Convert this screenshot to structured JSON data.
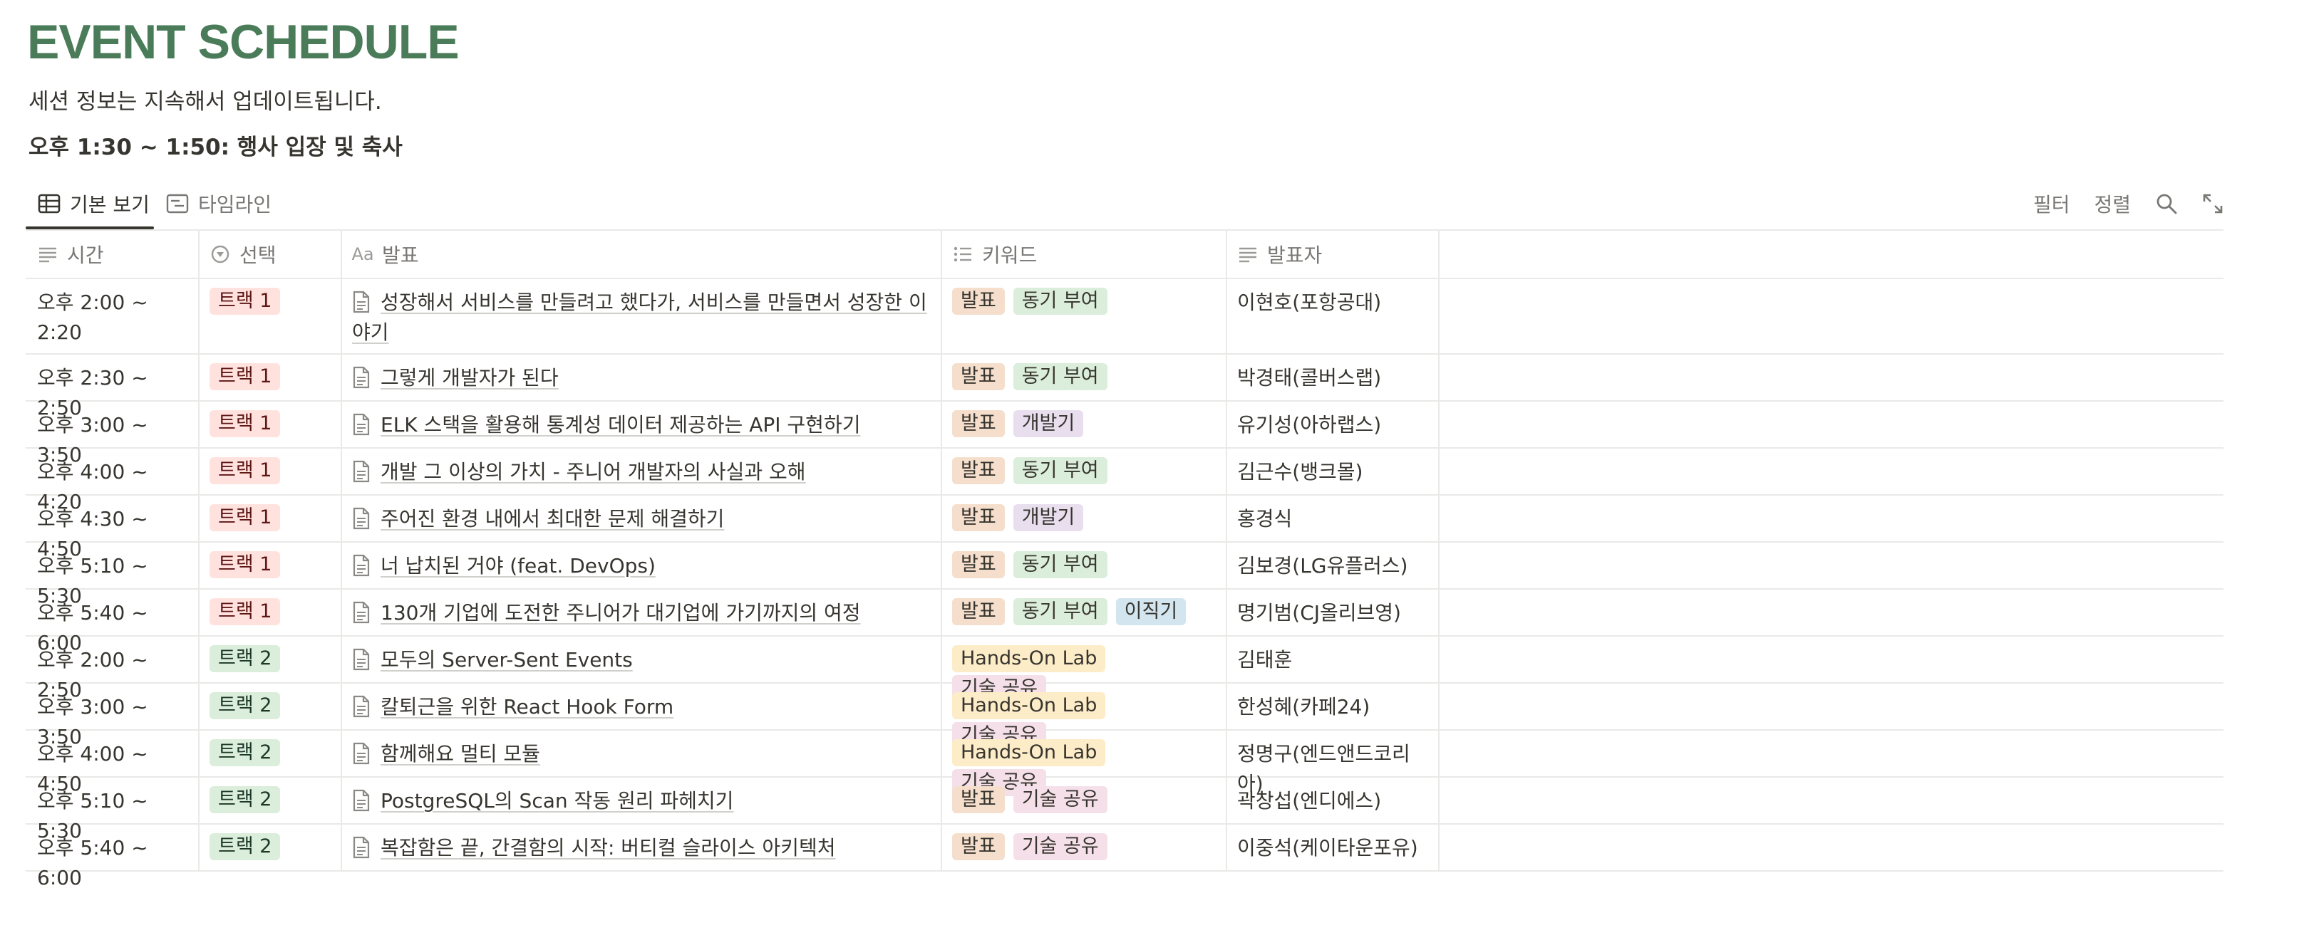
{
  "page": {
    "title": "EVENT SCHEDULE",
    "subtitle": "세션 정보는 지속해서 업데이트됩니다.",
    "notice": "오후 1:30 ~ 1:50: 행사 입장 및 축사"
  },
  "views": {
    "tabs": [
      {
        "label": "기본 보기",
        "icon": "table-icon",
        "active": true
      },
      {
        "label": "타임라인",
        "icon": "timeline-icon",
        "active": false
      }
    ],
    "filter_label": "필터",
    "sort_label": "정렬",
    "search_icon": "search-icon",
    "expand_icon": "expand-icon"
  },
  "columns": [
    {
      "label": "시간",
      "icon": "text-lines-icon"
    },
    {
      "label": "선택",
      "icon": "select-circle-icon"
    },
    {
      "label": "발표",
      "icon": "title-aa-icon",
      "icon_text": "Aa"
    },
    {
      "label": "키워드",
      "icon": "multi-select-list-icon"
    },
    {
      "label": "발표자",
      "icon": "text-lines-icon"
    }
  ],
  "colors": {
    "title": "#4a7c59",
    "track1_bg": "#ffe2dd",
    "track2_bg": "#dbeddb"
  },
  "rows": [
    {
      "time": "오후 2:00 ~ 2:20",
      "track": "트랙 1",
      "track_color": "red",
      "title": "성장해서 서비스를 만들려고 했다가, 서비스를 만들면서 성장한 이야기",
      "keywords": [
        {
          "label": "발표",
          "color": "brown"
        },
        {
          "label": "동기 부여",
          "color": "green"
        }
      ],
      "speaker": "이현호(포항공대)"
    },
    {
      "time": "오후 2:30 ~ 2:50",
      "track": "트랙 1",
      "track_color": "red",
      "title": "그렇게 개발자가 된다",
      "keywords": [
        {
          "label": "발표",
          "color": "brown"
        },
        {
          "label": "동기 부여",
          "color": "green"
        }
      ],
      "speaker": "박경태(콜버스랩)"
    },
    {
      "time": "오후 3:00 ~ 3:50",
      "track": "트랙 1",
      "track_color": "red",
      "title": "ELK 스택을 활용해 통계성 데이터 제공하는 API 구현하기",
      "keywords": [
        {
          "label": "발표",
          "color": "brown"
        },
        {
          "label": "개발기",
          "color": "purple"
        }
      ],
      "speaker": "유기성(아하랩스)"
    },
    {
      "time": "오후 4:00 ~ 4:20",
      "track": "트랙 1",
      "track_color": "red",
      "title": "개발 그 이상의 가치 - 주니어 개발자의 사실과 오해",
      "keywords": [
        {
          "label": "발표",
          "color": "brown"
        },
        {
          "label": "동기 부여",
          "color": "green"
        }
      ],
      "speaker": "김근수(뱅크몰)"
    },
    {
      "time": "오후 4:30 ~ 4:50",
      "track": "트랙 1",
      "track_color": "red",
      "title": "주어진 환경 내에서 최대한 문제 해결하기",
      "keywords": [
        {
          "label": "발표",
          "color": "brown"
        },
        {
          "label": "개발기",
          "color": "purple"
        }
      ],
      "speaker": "홍경식"
    },
    {
      "time": "오후 5:10 ~ 5:30",
      "track": "트랙 1",
      "track_color": "red",
      "title": "너 납치된 거야 (feat. DevOps)",
      "keywords": [
        {
          "label": "발표",
          "color": "brown"
        },
        {
          "label": "동기 부여",
          "color": "green"
        }
      ],
      "speaker": "김보경(LG유플러스)"
    },
    {
      "time": "오후 5:40 ~ 6:00",
      "track": "트랙 1",
      "track_color": "red",
      "title": "130개 기업에 도전한 주니어가 대기업에 가기까지의 여정",
      "keywords": [
        {
          "label": "발표",
          "color": "brown"
        },
        {
          "label": "동기 부여",
          "color": "green"
        },
        {
          "label": "이직기",
          "color": "blue"
        }
      ],
      "speaker": "명기범(CJ올리브영)"
    },
    {
      "time": "오후 2:00 ~ 2:50",
      "track": "트랙 2",
      "track_color": "green",
      "title": "모두의 Server-Sent Events",
      "keywords": [
        {
          "label": "Hands-On Lab",
          "color": "yellow"
        },
        {
          "label": "기술 공유",
          "color": "pink"
        }
      ],
      "speaker": "김태훈"
    },
    {
      "time": "오후 3:00 ~ 3:50",
      "track": "트랙 2",
      "track_color": "green",
      "title": "칼퇴근을 위한 React Hook Form",
      "keywords": [
        {
          "label": "Hands-On Lab",
          "color": "yellow"
        },
        {
          "label": "기술 공유",
          "color": "pink"
        }
      ],
      "speaker": "한성혜(카페24)"
    },
    {
      "time": "오후 4:00 ~ 4:50",
      "track": "트랙 2",
      "track_color": "green",
      "title": "함께해요 멀티 모듈",
      "keywords": [
        {
          "label": "Hands-On Lab",
          "color": "yellow"
        },
        {
          "label": "기술 공유",
          "color": "pink"
        }
      ],
      "speaker": "정명구(엔드앤드코리아)"
    },
    {
      "time": "오후 5:10 ~ 5:30",
      "track": "트랙 2",
      "track_color": "green",
      "title": "PostgreSQL의 Scan 작동 원리 파헤치기",
      "keywords": [
        {
          "label": "발표",
          "color": "brown"
        },
        {
          "label": "기술 공유",
          "color": "pink"
        }
      ],
      "speaker": "곽창섭(엔디에스)"
    },
    {
      "time": "오후 5:40 ~ 6:00",
      "track": "트랙 2",
      "track_color": "green",
      "title": "복잡함은 끝, 간결함의 시작: 버티컬 슬라이스 아키텍처",
      "keywords": [
        {
          "label": "발표",
          "color": "brown"
        },
        {
          "label": "기술 공유",
          "color": "pink"
        }
      ],
      "speaker": "이중석(케이타운포유)"
    }
  ]
}
